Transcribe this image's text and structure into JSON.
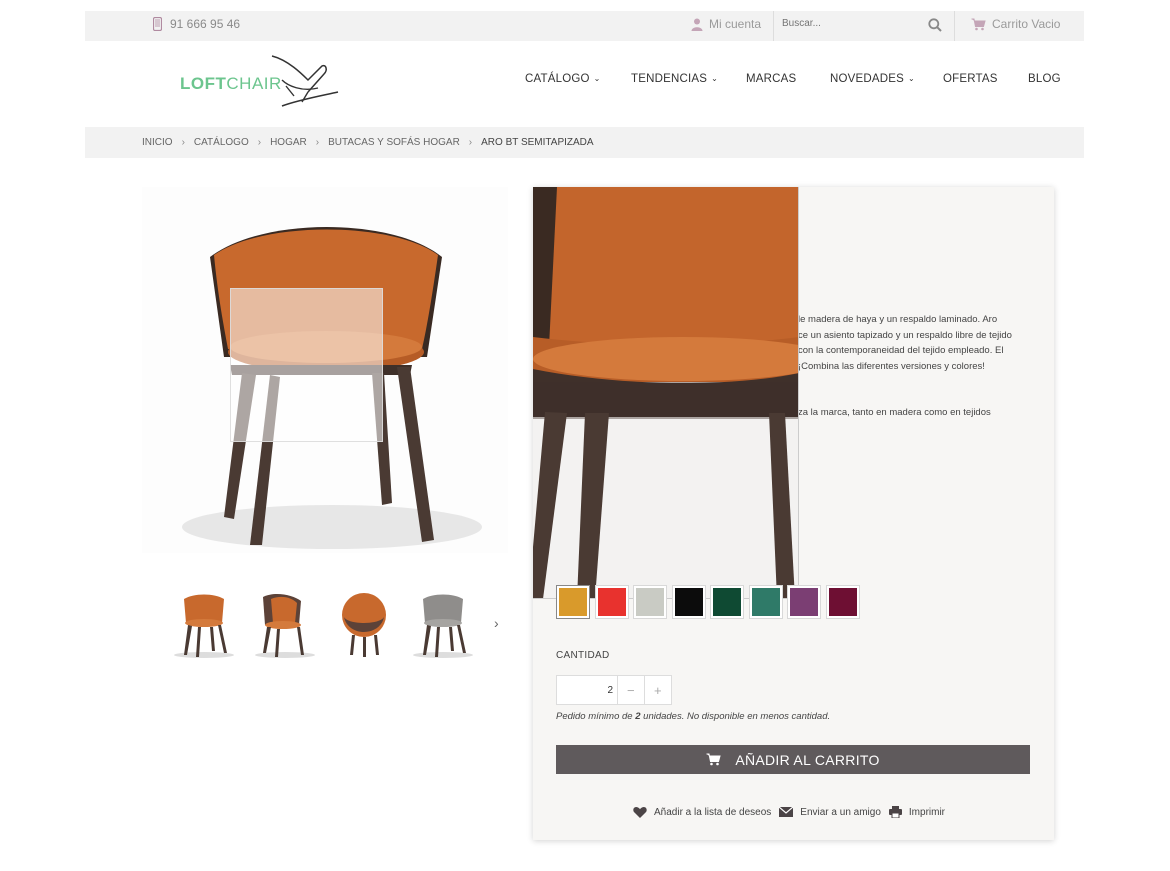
{
  "topbar": {
    "phone": "91 666 95 46",
    "account_label": "Mi cuenta",
    "search_placeholder": "Buscar...",
    "cart_label": "Carrito Vacio"
  },
  "logo": {
    "bold": "LOFT",
    "light": "CHAIR"
  },
  "nav": [
    {
      "label": "CATÁLOGO",
      "dropdown": true
    },
    {
      "label": "TENDENCIAS",
      "dropdown": true
    },
    {
      "label": "MARCAS",
      "dropdown": false
    },
    {
      "label": "NOVEDADES",
      "dropdown": true
    },
    {
      "label": "OFERTAS",
      "dropdown": false
    },
    {
      "label": "BLOG",
      "dropdown": false
    }
  ],
  "breadcrumb": [
    "INICIO",
    "CATÁLOGO",
    "HOGAR",
    "BUTACAS Y SOFÁS HOGAR",
    "ARO BT SEMITAPIZADA"
  ],
  "description": [
    "le madera de haya y un respaldo laminado. Aro",
    "ce un asiento tapizado y un respaldo libre de tejido",
    "con la contemporaneidad del tejido empleado. El",
    "¡Combina las diferentes versiones y colores!",
    "",
    "",
    "za la marca, tanto en madera como en tejidos"
  ],
  "swatches": [
    {
      "color": "#d99a2b",
      "selected": true
    },
    {
      "color": "#e8322e",
      "selected": false
    },
    {
      "color": "#c9cbc4",
      "selected": false
    },
    {
      "color": "#0c0c0c",
      "selected": false
    },
    {
      "color": "#0f4a33",
      "selected": false
    },
    {
      "color": "#2f7a68",
      "selected": false
    },
    {
      "color": "#7b3e73",
      "selected": false
    },
    {
      "color": "#6e0f33",
      "selected": false
    }
  ],
  "quantity": {
    "label": "CANTIDAD",
    "value": "2",
    "minus": "−",
    "plus": "+"
  },
  "min_note": {
    "prefix": "Pedido mínimo de ",
    "amount": "2",
    "suffix": " unidades. No disponible en menos cantidad."
  },
  "add_to_cart": "AÑADIR AL CARRITO",
  "actions": {
    "wishlist": "Añadir a la lista de deseos",
    "send": "Enviar a un amigo",
    "print": "Imprimir"
  },
  "colors": {
    "accent": "#6cc58e",
    "button": "#5f5a5c",
    "chair_orange": "#c8692d",
    "wood": "#4a3a33"
  }
}
